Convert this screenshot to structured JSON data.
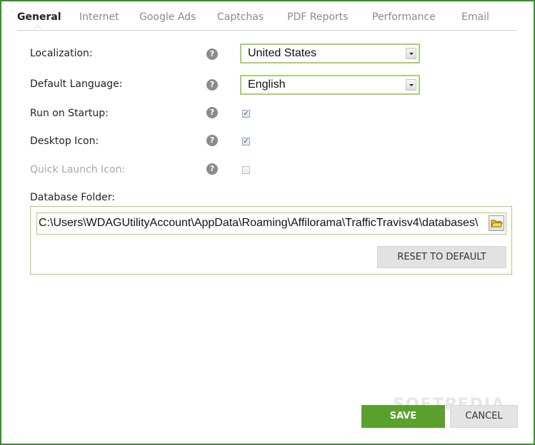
{
  "tabs": [
    {
      "label": "General",
      "active": true
    },
    {
      "label": "Internet",
      "active": false
    },
    {
      "label": "Google Ads",
      "active": false
    },
    {
      "label": "Captchas",
      "active": false
    },
    {
      "label": "PDF Reports",
      "active": false
    },
    {
      "label": "Performance",
      "active": false
    },
    {
      "label": "Email",
      "active": false
    }
  ],
  "settings": {
    "localization": {
      "label": "Localization:",
      "value": "United States"
    },
    "language": {
      "label": "Default Language:",
      "value": "English"
    },
    "startup": {
      "label": "Run on Startup:",
      "checked": true
    },
    "desktop_icon": {
      "label": "Desktop Icon:",
      "checked": true
    },
    "quick_launch": {
      "label": "Quick Launch Icon:",
      "checked": false,
      "disabled": true
    },
    "help_glyph": "?"
  },
  "database": {
    "label": "Database Folder:",
    "path": "C:\\Users\\WDAGUtilityAccount\\AppData\\Roaming\\Affilorama\\TrafficTravisv4\\databases\\",
    "reset_label": "RESET TO DEFAULT"
  },
  "footer": {
    "save_label": "SAVE",
    "cancel_label": "CANCEL"
  },
  "watermark": "SOFTPEDIA",
  "colors": {
    "frame": "#3a8f2e",
    "field_border": "#a9cf70",
    "save": "#5aa02c"
  },
  "icons": {
    "help": "help-icon",
    "browse": "folder-open-icon",
    "dropdown": "chevron-down-icon"
  }
}
